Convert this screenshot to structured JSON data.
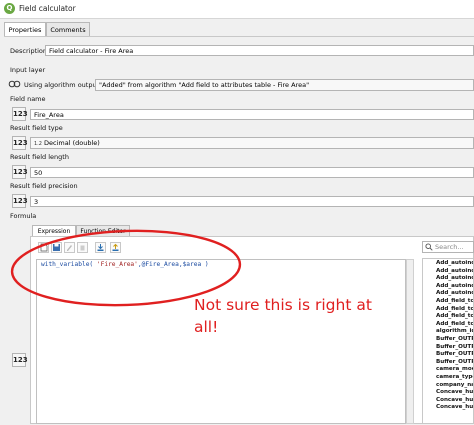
{
  "window": {
    "title": "Field calculator"
  },
  "tabs": [
    {
      "label": "Properties"
    },
    {
      "label": "Comments"
    }
  ],
  "properties": {
    "description_label": "Description",
    "description_value": "Field calculator - Fire Area",
    "input_layer_label": "Input layer",
    "using_output_label": "Using algorithm output",
    "input_layer_value": "\"Added\" from algorithm \"Add field to attributes table - Fire Area\"",
    "field_name_label": "Field name",
    "field_name_value": "Fire_Area",
    "result_type_label": "Result field type",
    "result_type_prefix": "1.2",
    "result_type_value": "Decimal (double)",
    "result_length_label": "Result field length",
    "result_length_value": "50",
    "result_precision_label": "Result field precision",
    "result_precision_value": "3",
    "formula_label": "Formula",
    "param_button_glyph": "123"
  },
  "formula_tabs": [
    {
      "label": "Expression"
    },
    {
      "label": "Function Editor"
    }
  ],
  "expression": {
    "fn": "with_variable(",
    "arg_string": "'Fire_Area'",
    "rest": ",@Fire_Area,$area )"
  },
  "search": {
    "placeholder": "Search..."
  },
  "function_list": [
    "Add_autoinc",
    "Add_autoinc",
    "Add_autoinc",
    "Add_autoinc",
    "Add_autoinc",
    "Add_field_to",
    "Add_field_to",
    "Add_field_to",
    "Add_field_to",
    "algorithm_id",
    "Buffer_OUTP",
    "Buffer_OUTP",
    "Buffer_OUTP",
    "Buffer_OUTP",
    "camera_mode",
    "camera_type",
    "company_na",
    "Concave_hu",
    "Concave_hu",
    "Concave_hu"
  ],
  "annotation": {
    "text_line1": "Not sure this is right at",
    "text_line2": "all!",
    "color": "#e02020"
  },
  "colors": {
    "qgis_logo": "#6aa843",
    "annotation": "#e02020"
  }
}
